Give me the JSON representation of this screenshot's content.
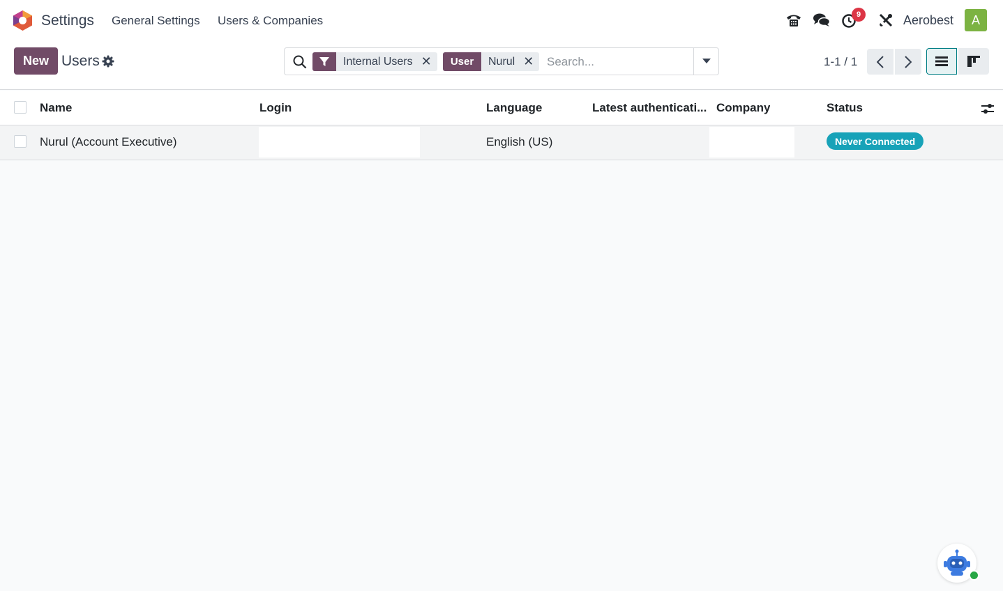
{
  "navbar": {
    "app_name": "Settings",
    "menu": [
      "General Settings",
      "Users & Companies"
    ],
    "activity_count": "9",
    "company": "Aerobest",
    "avatar_letter": "A"
  },
  "control_panel": {
    "new_label": "New",
    "breadcrumb": "Users",
    "search": {
      "facets": [
        {
          "label_icon": "filter-icon",
          "value": "Internal Users"
        },
        {
          "label": "User",
          "value": "Nurul"
        }
      ],
      "placeholder": "Search..."
    },
    "pager": "1-1 / 1"
  },
  "table": {
    "columns": [
      "Name",
      "Login",
      "Language",
      "Latest authenticati...",
      "Company",
      "Status"
    ],
    "rows": [
      {
        "name": "Nurul (Account Executive)",
        "login": "",
        "language": "English (US)",
        "latest_auth": "",
        "company": "",
        "status": "Never Connected"
      }
    ]
  },
  "colors": {
    "brand": "#714b67",
    "status": "#17a2b8",
    "avatar": "#7cb342",
    "badge": "#dc3545"
  }
}
